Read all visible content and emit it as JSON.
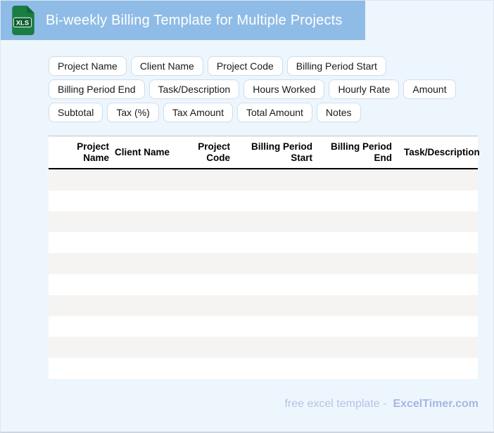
{
  "header": {
    "title": "Bi-weekly Billing Template for Multiple Projects",
    "file_icon_label": "XLS"
  },
  "chips": [
    "Project Name",
    "Client Name",
    "Project Code",
    "Billing Period Start",
    "Billing Period End",
    "Task/Description",
    "Hours Worked",
    "Hourly Rate",
    "Amount",
    "Subtotal",
    "Tax (%)",
    "Tax Amount",
    "Total Amount",
    "Notes"
  ],
  "table": {
    "columns": [
      "Project Name",
      "Client Name",
      "Project Code",
      "Billing Period Start",
      "Billing Period End",
      "Task/Description"
    ],
    "empty_row_count": 10
  },
  "footer": {
    "text": "free excel template -",
    "brand": "ExcelTimer.com"
  },
  "colors": {
    "header_bg": "#8fbce7",
    "page_bg": "#eef6fd",
    "stripe": "#f5f4f2",
    "chip_border": "#cbddef",
    "footer_text": "#b5c2e6",
    "footer_brand": "#a6b6e3",
    "icon_green": "#1b7d42",
    "icon_green_dark": "#0d5c30"
  }
}
